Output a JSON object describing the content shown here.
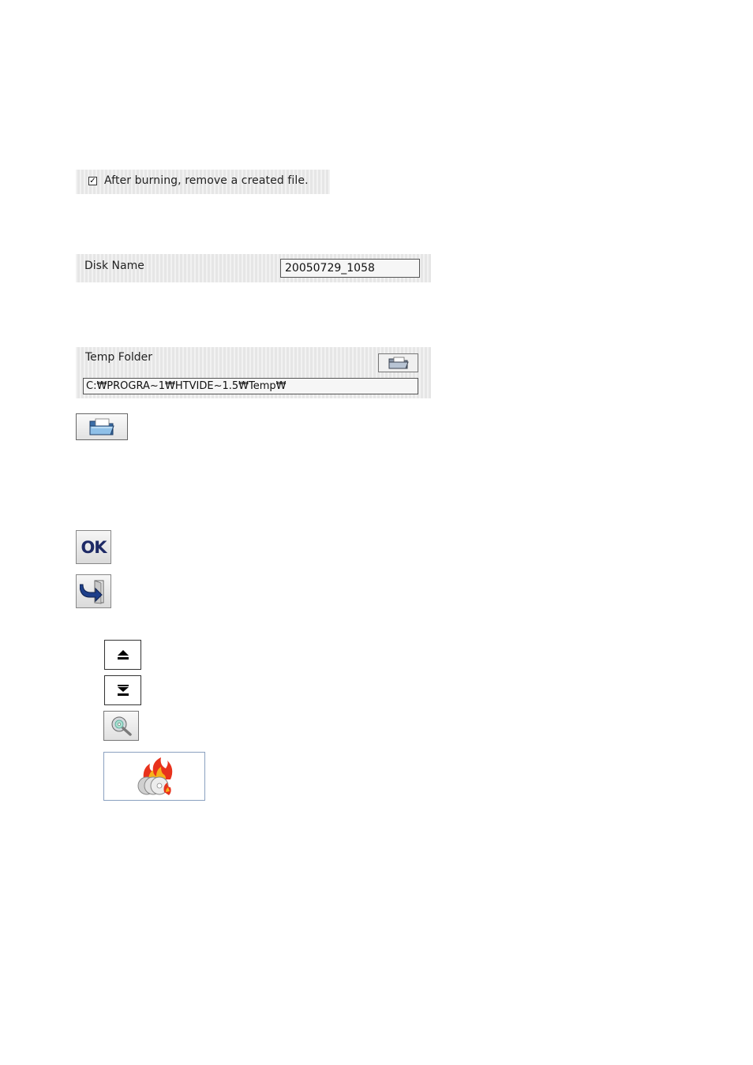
{
  "options": {
    "remove_file_checked": true,
    "check_mark": "✓",
    "remove_file_label": "After burning, remove a created file."
  },
  "disk": {
    "label": "Disk Name",
    "value": "20050729_1058"
  },
  "temp": {
    "label": "Temp Folder",
    "path": "C:₩PROGRA~1₩HTVIDE~1.5₩Temp₩",
    "browse_icon": "folder-open-icon"
  },
  "buttons": {
    "folder_icon": "folder-open-icon",
    "ok_label": "OK",
    "exit_icon": "exit-arrow-icon",
    "up_icon": "eject-up-icon",
    "down_icon": "move-down-icon",
    "search_icon": "disc-search-icon",
    "burn_icon": "burn-disc-icon"
  },
  "colors": {
    "panel_bg": "#ebebeb",
    "ok_text": "#1e2a66",
    "exit_arrow": "#1e3f8a",
    "flame_outer": "#e8321c",
    "flame_inner": "#f7b21a"
  }
}
